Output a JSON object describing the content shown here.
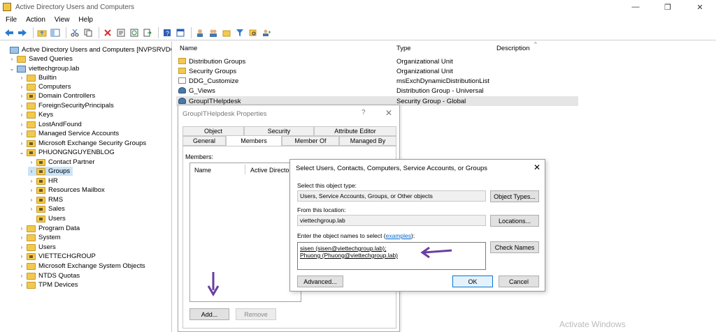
{
  "window": {
    "title": "Active Directory Users and Computers",
    "controls": [
      "—",
      "❐",
      "✕"
    ]
  },
  "menu": [
    "File",
    "Action",
    "View",
    "Help"
  ],
  "toolbar": {
    "icons": [
      "back-arrow-icon",
      "forward-arrow-icon",
      "sep",
      "up-folder-icon",
      "show-console-tree-icon",
      "sep",
      "cut-icon",
      "copy-icon",
      "sep",
      "delete-icon",
      "properties-icon",
      "refresh-icon",
      "export-list-icon",
      "sep",
      "help-icon",
      "console-icon",
      "sep",
      "new-user-icon",
      "new-group-icon",
      "new-ou-icon",
      "filter-icon",
      "find-icon",
      "add-to-group-icon"
    ]
  },
  "tree": {
    "root": "Active Directory Users and Computers [NVPSRVDC0",
    "saved_queries": "Saved Queries",
    "domain": "viettechgroup.lab",
    "children": [
      "Builtin",
      "Computers",
      "Domain Controllers",
      "ForeignSecurityPrincipals",
      "Keys",
      "LostAndFound",
      "Managed Service Accounts",
      "Microsoft Exchange Security Groups"
    ],
    "ou": "PHUONGNGUYENBLOG",
    "ou_children": [
      "Contact Partner",
      "Groups",
      "HR",
      "Resources Mailbox",
      "RMS",
      "Sales",
      "Users"
    ],
    "rest": [
      "Program Data",
      "System",
      "Users",
      "VIETTECHGROUP",
      "Microsoft Exchange System Objects",
      "NTDS Quotas",
      "TPM Devices"
    ]
  },
  "list": {
    "headers": {
      "name": "Name",
      "type": "Type",
      "description": "Description"
    },
    "rows": [
      {
        "name": "Distribution Groups",
        "type": "Organizational Unit",
        "icon": "ou"
      },
      {
        "name": "Security  Groups",
        "type": "Organizational Unit",
        "icon": "ou"
      },
      {
        "name": "DDG_Customize",
        "type": "msExchDynamicDistributionList",
        "icon": "ddl"
      },
      {
        "name": "G_Views",
        "type": "Distribution Group - Universal",
        "icon": "group"
      },
      {
        "name": "GroupITHelpdesk",
        "type": "Security Group - Global",
        "icon": "group"
      }
    ]
  },
  "props": {
    "title": "GroupITHelpdesk Properties",
    "help": "?",
    "close": "✕",
    "tabs_top": [
      "Object",
      "Security",
      "Attribute Editor"
    ],
    "tabs_bottom": [
      "General",
      "Members",
      "Member Of",
      "Managed By"
    ],
    "members_label": "Members:",
    "col_name": "Name",
    "col_folder": "Active Directory",
    "add": "Add...",
    "remove": "Remove"
  },
  "select_dialog": {
    "title": "Select Users, Contacts, Computers, Service Accounts, or Groups",
    "close": "✕",
    "object_type_label": "Select this object type:",
    "object_type_value": "Users, Service Accounts, Groups, or Other objects",
    "object_types_btn": "Object Types...",
    "location_label": "From this location:",
    "location_value": "viettechgroup.lab",
    "locations_btn": "Locations...",
    "enter_label_prefix": "Enter the object names to select (",
    "enter_label_link": "examples",
    "enter_label_suffix": "):",
    "entry_line1": "sisen (sisen@viettechgroup.lab);",
    "entry_line2": "Phuong (Phuong@viettechgroup.lab)",
    "check_names_btn": "Check Names",
    "advanced_btn": "Advanced...",
    "ok_btn": "OK",
    "cancel_btn": "Cancel"
  },
  "watermark": "Activate Windows",
  "colors": {
    "accent": "#0078d7",
    "arrow": "#6a3ea1",
    "selection": "#cce4f7"
  }
}
